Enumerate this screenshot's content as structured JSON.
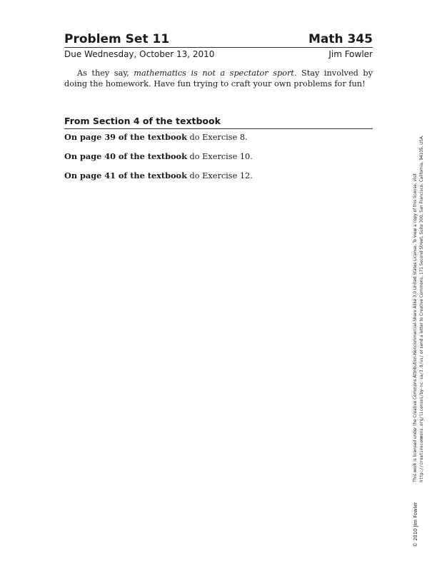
{
  "header": {
    "title": "Problem Set 11",
    "course": "Math 345",
    "due": "Due Wednesday, October 13, 2010",
    "author": "Jim Fowler"
  },
  "intro": {
    "prefix": "As they say, ",
    "emphasis": "mathematics is not a spectator sport.",
    "suffix": " Stay involved by doing the homework. Have fun trying to craft your own problems for fun!"
  },
  "section": {
    "title": "From Section 4 of the textbook"
  },
  "problems": [
    {
      "label": "On page 39 of the textbook",
      "text": " do Exercise 8."
    },
    {
      "label": "On page 40 of the textbook",
      "text": " do Exercise 10."
    },
    {
      "label": "On page 41 of the textbook",
      "text": " do Exercise 12."
    }
  ],
  "footer": {
    "copyright": "© 2010 Jim Fowler",
    "license_line1": "This work is licensed under the Creative Commons Attribution-Noncommercial-Share Alike 3.0 United States License. To view a copy of this license, visit",
    "license_url": "http://creativecommons.org/licenses/by-nc-sa/3.0/us/",
    "license_line2_rest": " or send a letter to Creative Commons, 171 Second Street, Suite 300, San Francisco, California, 94105, USA."
  }
}
